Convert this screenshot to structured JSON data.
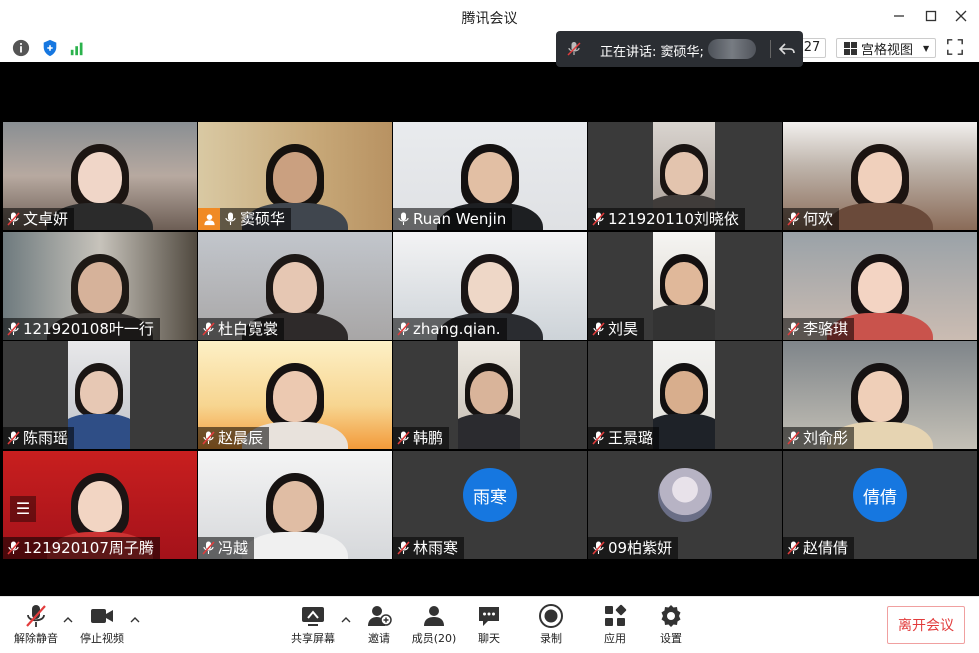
{
  "window": {
    "title": "腾讯会议"
  },
  "toolbar": {
    "participant_count": "27",
    "view_mode": "宫格视图"
  },
  "speaking": {
    "label": "正在讲话: 窦硕华;"
  },
  "participants": [
    {
      "name": "文卓妍"
    },
    {
      "name": "窦硕华"
    },
    {
      "name": "Ruan Wenjin"
    },
    {
      "name": "121920110刘晓依"
    },
    {
      "name": "何欢"
    },
    {
      "name": "121920108叶一行"
    },
    {
      "name": "杜白霓裳"
    },
    {
      "name": "zhang.qian."
    },
    {
      "name": "刘昊"
    },
    {
      "name": "李骆琪"
    },
    {
      "name": "陈雨瑶"
    },
    {
      "name": "赵晨辰"
    },
    {
      "name": "韩鹏"
    },
    {
      "name": "王景璐"
    },
    {
      "name": "刘俞彤"
    },
    {
      "name": "121920107周子腾"
    },
    {
      "name": "冯越"
    },
    {
      "name": "林雨寒",
      "avatar_text": "雨寒"
    },
    {
      "name": "09柏紫妍"
    },
    {
      "name": "赵倩倩",
      "avatar_text": "倩倩"
    }
  ],
  "controls": {
    "unmute": "解除静音",
    "stop_video": "停止视频",
    "share_screen": "共享屏幕",
    "invite": "邀请",
    "members": "成员(20)",
    "chat": "聊天",
    "record": "录制",
    "apps": "应用",
    "settings": "设置",
    "leave": "离开会议"
  },
  "colors": {
    "accent_blue": "#1677e0",
    "leave_red": "#e23c3c",
    "active_green": "#3cc86d",
    "host_orange": "#f08a24"
  }
}
